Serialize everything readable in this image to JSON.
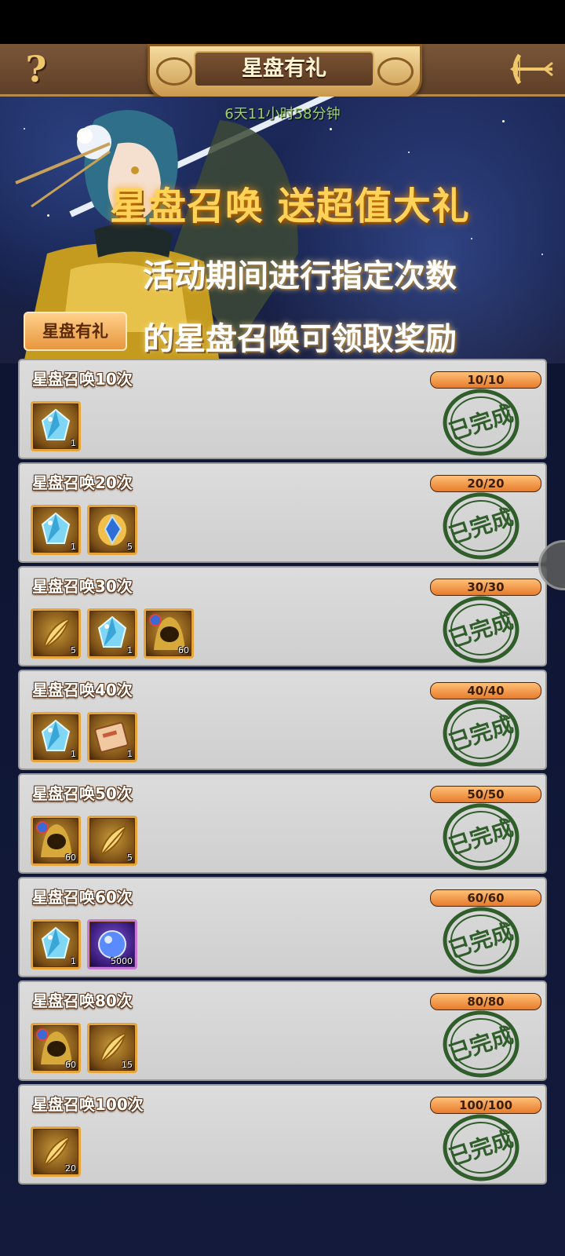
{
  "header": {
    "title": "星盘有礼",
    "help_label": "?",
    "back_icon": "bow-arrow-back-icon"
  },
  "banner": {
    "countdown": "6天11小时58分钟",
    "headline": "星盘召唤 送超值大礼",
    "line1": "活动期间进行指定次数",
    "line2": "的星盘召唤可领取奖励",
    "tag": "星盘有礼"
  },
  "colors": {
    "accent_gold": "#ffd35a",
    "progress_orange": "#e77b2a",
    "stamp_green": "#2f5e2a",
    "countdown_green": "#9bd466"
  },
  "tasks": [
    {
      "title": "星盘召唤10次",
      "progress": "10/10",
      "fraction": 1.0,
      "status": "已完成",
      "rewards": [
        {
          "icon": "blue-crystal-icon",
          "qty": "1"
        }
      ]
    },
    {
      "title": "星盘召唤20次",
      "progress": "20/20",
      "fraction": 1.0,
      "status": "已完成",
      "rewards": [
        {
          "icon": "blue-crystal-icon",
          "qty": "1"
        },
        {
          "icon": "blue-gem-icon",
          "qty": "5"
        }
      ]
    },
    {
      "title": "星盘召唤30次",
      "progress": "30/30",
      "fraction": 1.0,
      "status": "已完成",
      "rewards": [
        {
          "icon": "golden-feather-icon",
          "qty": "5"
        },
        {
          "icon": "blue-crystal-icon",
          "qty": "1"
        },
        {
          "icon": "hero-shard-icon",
          "qty": "60"
        }
      ]
    },
    {
      "title": "星盘召唤40次",
      "progress": "40/40",
      "fraction": 1.0,
      "status": "已完成",
      "rewards": [
        {
          "icon": "blue-crystal-icon",
          "qty": "1"
        },
        {
          "icon": "ticket-icon",
          "qty": "1"
        }
      ]
    },
    {
      "title": "星盘召唤50次",
      "progress": "50/50",
      "fraction": 1.0,
      "status": "已完成",
      "rewards": [
        {
          "icon": "hero-shard-icon",
          "qty": "60"
        },
        {
          "icon": "golden-feather-icon",
          "qty": "5"
        }
      ]
    },
    {
      "title": "星盘召唤60次",
      "progress": "60/60",
      "fraction": 1.0,
      "status": "已完成",
      "rewards": [
        {
          "icon": "blue-crystal-icon",
          "qty": "1"
        },
        {
          "icon": "purple-orb-icon",
          "qty": "5000"
        }
      ]
    },
    {
      "title": "星盘召唤80次",
      "progress": "80/80",
      "fraction": 1.0,
      "status": "已完成",
      "rewards": [
        {
          "icon": "hero-shard-icon",
          "qty": "60"
        },
        {
          "icon": "golden-feather-icon",
          "qty": "15"
        }
      ]
    },
    {
      "title": "星盘召唤100次",
      "progress": "100/100",
      "fraction": 1.0,
      "status": "已完成",
      "rewards": [
        {
          "icon": "golden-feather-icon",
          "qty": "20"
        }
      ]
    }
  ]
}
